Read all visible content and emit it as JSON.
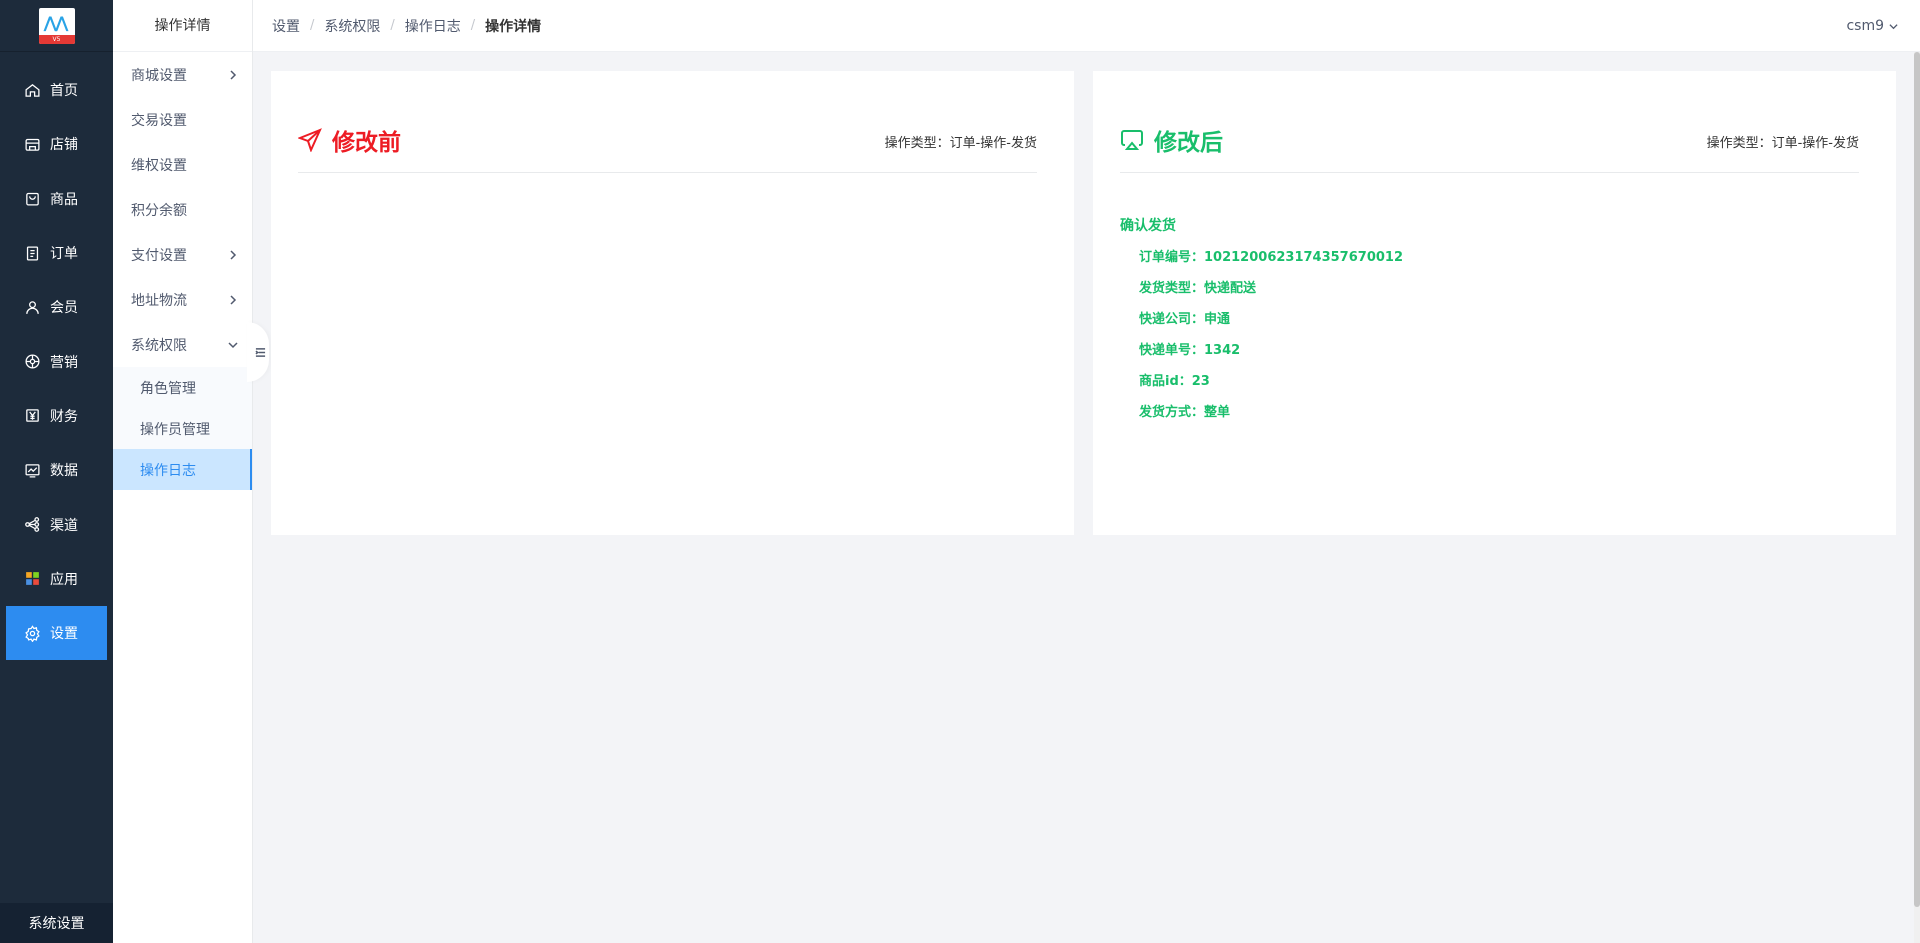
{
  "nav": {
    "logo_text": "V5",
    "items": [
      {
        "label": "首页",
        "icon": "home-icon"
      },
      {
        "label": "店铺",
        "icon": "store-icon"
      },
      {
        "label": "商品",
        "icon": "bag-icon"
      },
      {
        "label": "订单",
        "icon": "order-icon"
      },
      {
        "label": "会员",
        "icon": "user-icon"
      },
      {
        "label": "营销",
        "icon": "marketing-icon"
      },
      {
        "label": "财务",
        "icon": "yen-icon"
      },
      {
        "label": "数据",
        "icon": "chart-icon"
      },
      {
        "label": "渠道",
        "icon": "share-icon"
      },
      {
        "label": "应用",
        "icon": "apps-icon"
      },
      {
        "label": "设置",
        "icon": "gear-icon"
      }
    ],
    "active_index": 10,
    "bottom_label": "系统设置"
  },
  "submenu": {
    "title": "操作详情",
    "items": [
      {
        "label": "商城设置"
      },
      {
        "label": "交易设置"
      },
      {
        "label": "维权设置"
      },
      {
        "label": "积分余额"
      },
      {
        "label": "支付设置"
      },
      {
        "label": "地址物流"
      },
      {
        "label": "系统权限"
      }
    ],
    "children": [
      {
        "label": "角色管理"
      },
      {
        "label": "操作员管理"
      },
      {
        "label": "操作日志"
      }
    ],
    "active_child": 2
  },
  "header": {
    "breadcrumb": [
      "设置",
      "系统权限",
      "操作日志",
      "操作详情"
    ],
    "user": "csm9"
  },
  "before": {
    "title": "修改前",
    "op_type": "操作类型：订单-操作-发货"
  },
  "after": {
    "title": "修改后",
    "op_type": "操作类型：订单-操作-发货",
    "section_title": "确认发货",
    "rows": [
      "订单编号：1021200623174357670012",
      "发货类型：快递配送",
      "快递公司：申通",
      "快递单号：1342",
      "商品id：23",
      "发货方式：整单"
    ]
  },
  "colors": {
    "nav_bg": "#1d2b3b",
    "accent": "#2d8cf0",
    "before_red": "#ed1c24",
    "after_green": "#19be6b"
  }
}
